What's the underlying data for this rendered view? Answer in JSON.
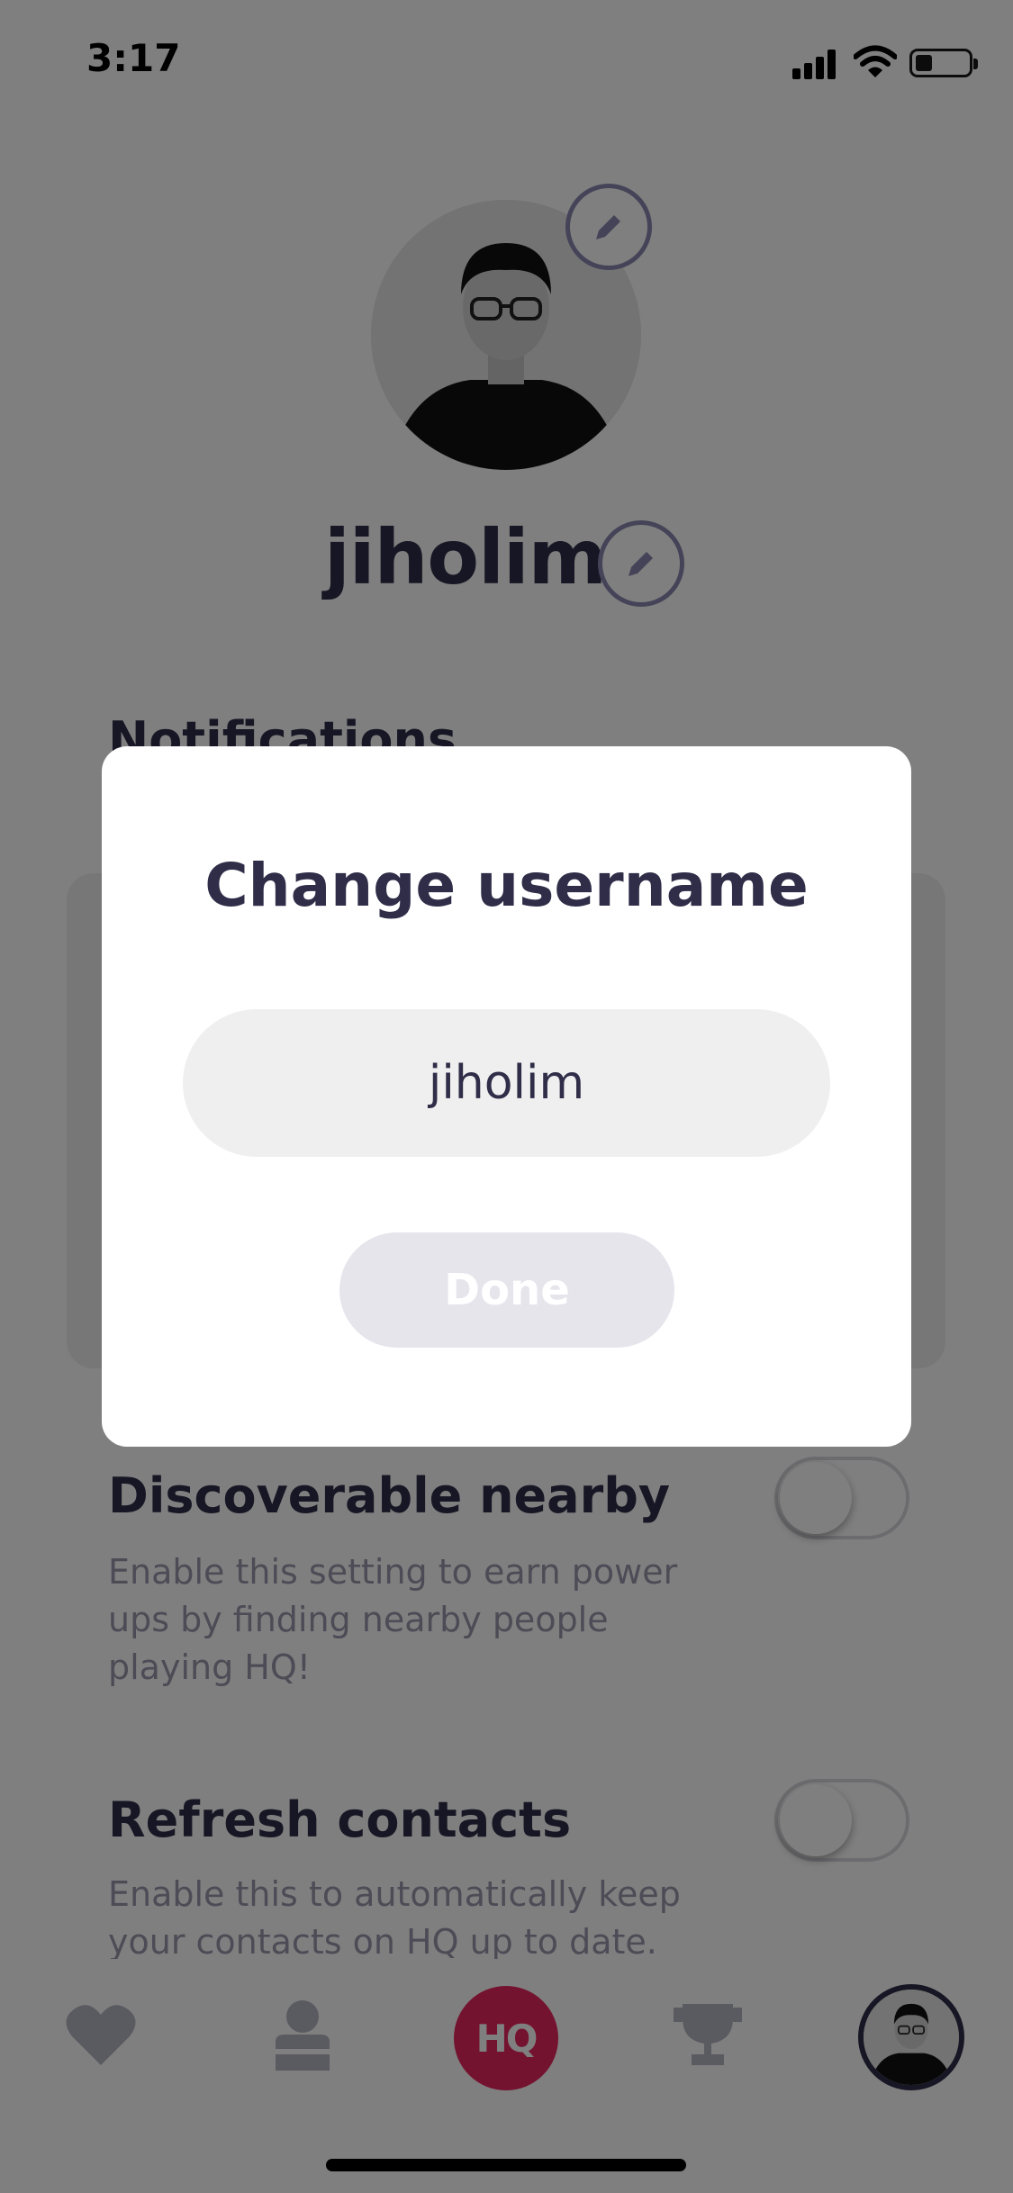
{
  "status_bar": {
    "time": "3:17",
    "icons": [
      "cellular-signal-icon",
      "wifi-icon",
      "battery-icon"
    ]
  },
  "profile": {
    "username": "jiholim",
    "avatar_icon": "profile-photo",
    "edit_icon": "pencil-icon"
  },
  "sections": {
    "notifications_title": "Notifications"
  },
  "settings": [
    {
      "title": "Discoverable nearby",
      "description": "Enable this setting to earn power ups by finding nearby people playing HQ!",
      "enabled": false
    },
    {
      "title": "Refresh contacts",
      "description": "Enable this to automatically keep your contacts on HQ up to date.",
      "enabled": false
    }
  ],
  "tab_bar": {
    "items": [
      "heart-icon",
      "person-icon",
      "hq-logo",
      "trophy-icon",
      "profile-avatar"
    ],
    "hq_label": "HQ"
  },
  "modal": {
    "title": "Change username",
    "input_value": "jiholim",
    "done_label": "Done"
  },
  "colors": {
    "text_primary": "#2f2d48",
    "text_secondary": "#9a98ad",
    "accent": "#e8265e",
    "overlay": "rgba(0,0,0,0.5)",
    "done_disabled_bg": "#e6e5ec",
    "input_bg": "#efefef"
  }
}
